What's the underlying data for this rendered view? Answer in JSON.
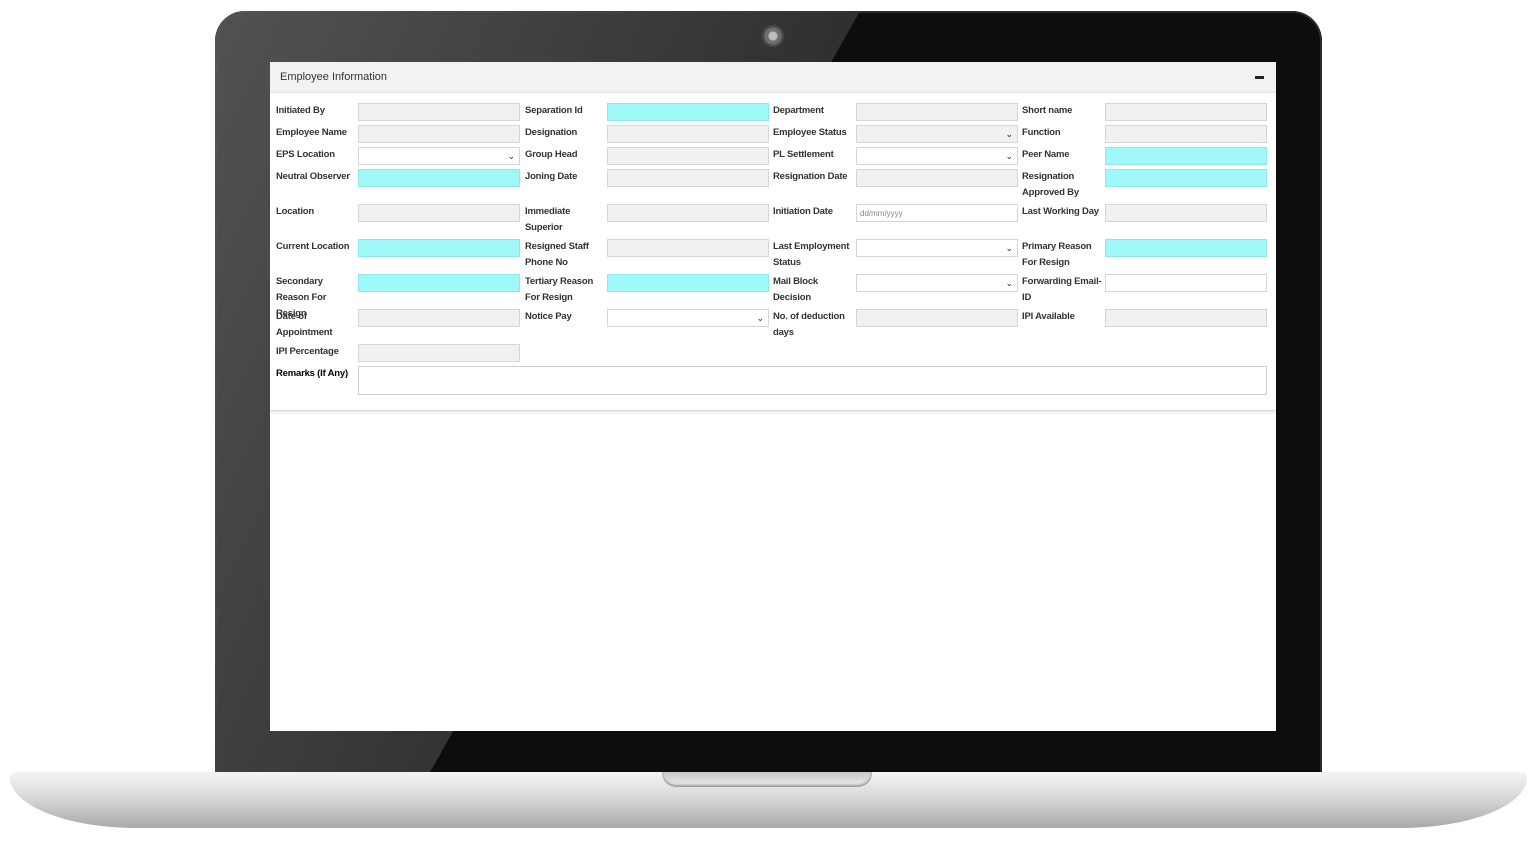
{
  "panel": {
    "title": "Employee Information",
    "collapse_icon": "minus-icon"
  },
  "fields": {
    "initiated_by": "Initiated By",
    "separation_id": "Separation Id",
    "department": "Department",
    "short_name": "Short name",
    "employee_name": "Employee Name",
    "designation": "Designation",
    "employee_status": "Employee Status",
    "function": "Function",
    "eps_location": "EPS Location",
    "group_head": "Group Head",
    "pl_settlement": "PL Settlement",
    "peer_name": "Peer Name",
    "neutral_observer": "Neutral Observer",
    "joining_date": "Joning Date",
    "resignation_date": "Resignation Date",
    "resignation_approved_by": "Resignation Approved By",
    "location": "Location",
    "immediate_superior": "Immediate Superior",
    "initiation_date": "Initiation Date",
    "last_working_day": "Last Working Day",
    "current_location": "Current Location",
    "resigned_staff_phone": "Resigned Staff Phone No",
    "last_employment_status": "Last Employment Status",
    "primary_reason": "Primary Reason For Resign",
    "secondary_reason": "Secondary Reason For Resign",
    "tertiary_reason": "Tertiary Reason For Resign",
    "mail_block_decision": "Mail Block Decision",
    "forwarding_email": "Forwarding Email-ID",
    "date_of_appointment": "Date of Appointment",
    "notice_pay": "Notice Pay",
    "deduction_days": "No. of deduction days",
    "ipi_available": "IPI Available",
    "ipi_percentage": "IPI Percentage",
    "remarks": "Remarks (If Any)"
  },
  "placeholders": {
    "initiation_date": "dd/mm/yyyy"
  },
  "colors": {
    "highlight_field": "#9ff9f9",
    "readonly_field": "#f1f1f1"
  }
}
